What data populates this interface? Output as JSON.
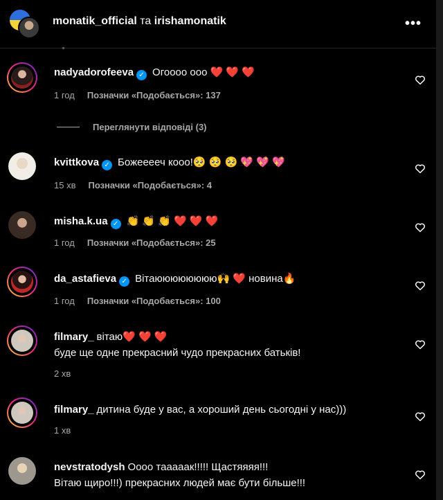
{
  "header": {
    "user1": "monatik_official",
    "joiner": "та",
    "user2": "irishamonatik",
    "more_icon": "more-horizontal-icon"
  },
  "comments": [
    {
      "user": "nadyadorofeeva",
      "verified": true,
      "text": "Огоооо ооо ❤️ ❤️ ❤️",
      "time": "1 год",
      "likes": "Позначки «Подобається»: 137",
      "avatar_color": "#8a3a3a"
    },
    {
      "user": "kvittkova",
      "verified": true,
      "text": "Божееееч кооо!🥺 🥺 🥺 💖 💖 💖",
      "time": "15 хв",
      "likes": "Позначки «Подобається»: 4",
      "avatar_color": "#cfc6bd"
    },
    {
      "user": "misha.k.ua",
      "verified": true,
      "text": "👏 👏 👏 ❤️ ❤️ ❤️",
      "time": "1 год",
      "likes": "Позначки «Подобається»: 25",
      "avatar_color": "#4a3a34"
    },
    {
      "user": "da_astafieva",
      "verified": true,
      "text": "Вітаюююююююю🙌 ❤️  новина🔥",
      "time": "1 год",
      "likes": "Позначки «Подобається»: 100",
      "avatar_color": "#b22a2a"
    },
    {
      "user": "filmary_",
      "verified": false,
      "text": "вітаю❤️ ❤️ ❤️",
      "text2": "буде ще одне прекрасний чудо прекрасних батьків!",
      "time": "2 хв",
      "likes": "",
      "avatar_color": "#d8d2c8"
    },
    {
      "user": "filmary_",
      "verified": false,
      "text": "дитина буде у вас, а хороший день сьогодні у нас)))",
      "time": "1 хв",
      "likes": "",
      "avatar_color": "#d8d2c8"
    },
    {
      "user": "nevstratodysh",
      "verified": false,
      "text": "Оооо таааaак!!!!! Щастяяяя!!!",
      "text2": "Вітаю щиро!!!) прекрасних людей має бути більше!!!",
      "time": "",
      "likes": "",
      "avatar_color": "#bdb8b0"
    }
  ],
  "replies_label": "Переглянути відповіді (3)",
  "verified_icon": "verified-badge-icon",
  "like_icon": "heart-outline-icon"
}
